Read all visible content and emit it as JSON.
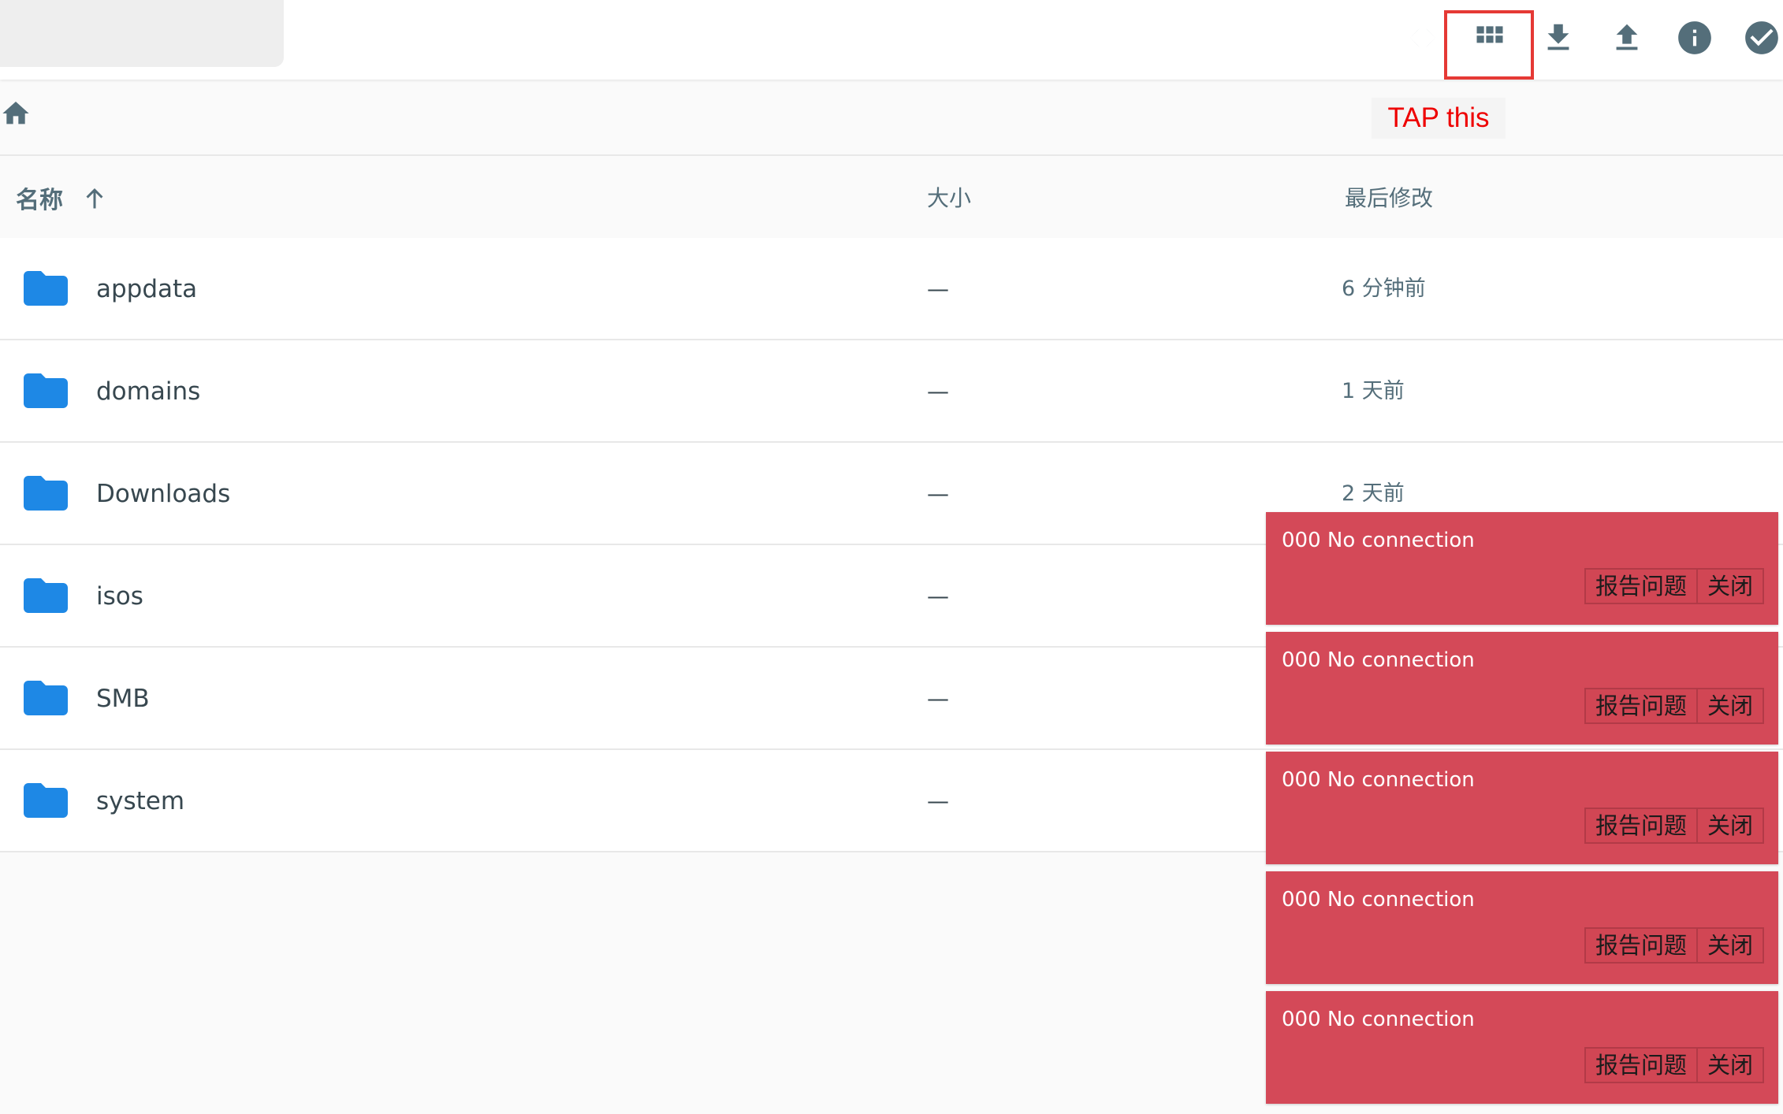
{
  "header": {
    "actions": [
      {
        "name": "code-view",
        "icon": "code-brackets-icon"
      },
      {
        "name": "grid-view",
        "icon": "grid-icon"
      },
      {
        "name": "download",
        "icon": "download-icon"
      },
      {
        "name": "upload",
        "icon": "upload-icon"
      },
      {
        "name": "info",
        "icon": "info-icon"
      },
      {
        "name": "select",
        "icon": "check-circle-icon"
      }
    ],
    "annotation": "TAP this",
    "annotation_color": "#ee0000"
  },
  "breadcrumb": {
    "home_icon": "home-icon"
  },
  "list": {
    "columns": {
      "name": "名称",
      "size": "大小",
      "modified": "最后修改"
    },
    "sort_icon": "arrow-up-icon",
    "rows": [
      {
        "name": "appdata",
        "size": "—",
        "modified": "6 分钟前"
      },
      {
        "name": "domains",
        "size": "—",
        "modified": "1 天前"
      },
      {
        "name": "Downloads",
        "size": "—",
        "modified": "2 天前"
      },
      {
        "name": "isos",
        "size": "—",
        "modified": ""
      },
      {
        "name": "SMB",
        "size": "—",
        "modified": ""
      },
      {
        "name": "system",
        "size": "—",
        "modified": ""
      }
    ],
    "folder_color": "#1e88e5"
  },
  "toasts": [
    {
      "message": "000 No connection",
      "report_label": "报告问题",
      "close_label": "关闭"
    },
    {
      "message": "000 No connection",
      "report_label": "报告问题",
      "close_label": "关闭"
    },
    {
      "message": "000 No connection",
      "report_label": "报告问题",
      "close_label": "关闭"
    },
    {
      "message": "000 No connection",
      "report_label": "报告问题",
      "close_label": "关闭"
    },
    {
      "message": "000 No connection",
      "report_label": "报告问题",
      "close_label": "关闭"
    }
  ],
  "colors": {
    "toast_bg": "#d44958",
    "icon": "#546e7a"
  }
}
